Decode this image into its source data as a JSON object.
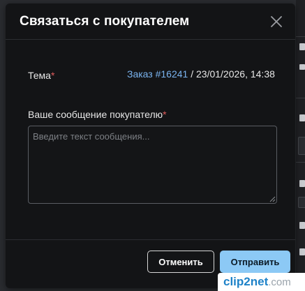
{
  "modal": {
    "title": "Связаться с покупателем",
    "subject": {
      "label": "Тема",
      "required_mark": "*",
      "order_link": "Заказ #16241",
      "date_text": " / 23/01/2026, 14:38"
    },
    "message": {
      "label": "Ваше сообщение покупателю",
      "required_mark": "*",
      "value": "",
      "placeholder": "Введите текст сообщения..."
    },
    "buttons": {
      "cancel": "Отменить",
      "send": "Отправить"
    }
  },
  "watermark": {
    "part1": "clip",
    "part2": "2net",
    "part3": ".com"
  },
  "colors": {
    "modal_bg": "#131416",
    "link": "#7ab4f0",
    "required": "#e05c5c",
    "primary_button": "#8cc9f5"
  },
  "icons": {
    "close": "close-icon",
    "resize": "resize-grip-icon"
  }
}
